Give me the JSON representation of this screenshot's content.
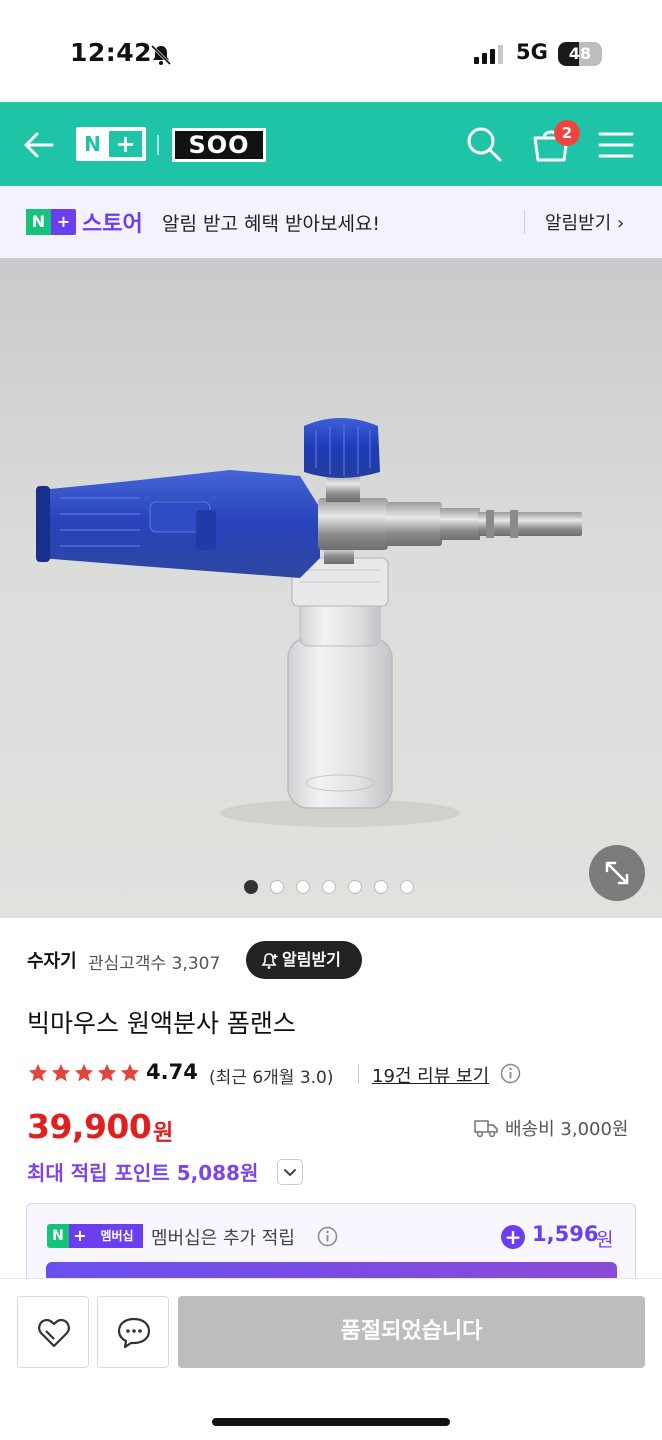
{
  "status_bar": {
    "time": "12:42",
    "network": "5G",
    "battery": "48",
    "battery_level": 0.48
  },
  "header": {
    "back_icon": "arrow-left-icon",
    "logo_n": "N",
    "logo_plus": "+",
    "brand_logo": "SOO",
    "cart_count": "2",
    "accent": "#1fc4a6"
  },
  "store_banner": {
    "logo_n": "N",
    "logo_plus": "+",
    "store_name": "스토어",
    "message": "알림 받고 혜택 받아보세요!",
    "action": "알림받기 ›"
  },
  "gallery": {
    "image_count": 7,
    "active_index": 0
  },
  "product": {
    "seller": "수자기",
    "watchers": "관심고객수 3,307",
    "notify_label": "알림받기",
    "title": "빅마우스 원액분사 폼랜스",
    "rating_stars": 5,
    "rating": "4.74",
    "recent_rating": "(최근 6개월 3.0)",
    "reviews_link": "19건 리뷰 보기",
    "price": "39,900",
    "currency": "원",
    "shipping": "배송비 3,000원",
    "max_points": "최대 적립 포인트 5,088원",
    "price_color": "#e02020",
    "point_color": "#7b45e8"
  },
  "membership": {
    "tag_n": "N",
    "tag_plus": "+",
    "tag_label": "멤버십",
    "text": "멤버십은 추가 적립",
    "amount": "1,596",
    "currency": "원"
  },
  "bottom_bar": {
    "wish_icon": "heart-icon",
    "chat_icon": "chat-bubble-icon",
    "sold_out_label": "품절되었습니다"
  }
}
